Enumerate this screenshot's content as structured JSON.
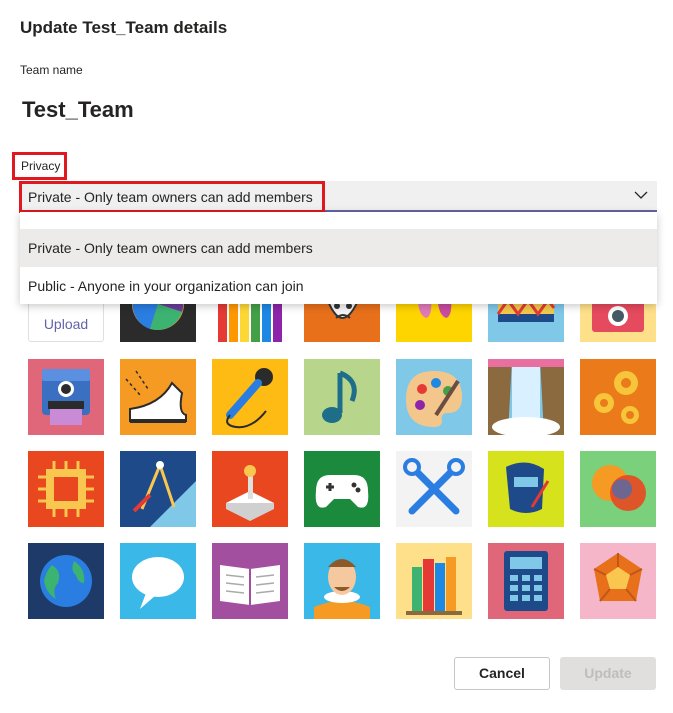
{
  "dialog": {
    "title": "Update Test_Team details",
    "team_name_label": "Team name",
    "team_name": "Test_Team",
    "privacy_label": "Privacy",
    "privacy_value": "Private - Only team owners can add members",
    "options": [
      "Private - Only team owners can add members",
      "Public - Anyone in your organization can join"
    ],
    "upload_label": "Upload",
    "cancel_label": "Cancel",
    "update_label": "Update"
  },
  "icons": {
    "row1": [
      "pie-chart-icon",
      "colored-pencils-icon",
      "theater-mask-icon",
      "ballet-shoes-icon",
      "drum-icon",
      "camera-icon"
    ],
    "row2": [
      "instant-camera-icon",
      "dance-shoe-icon",
      "microphone-icon",
      "music-note-icon",
      "paint-palette-icon",
      "waterfall-icon",
      "gears-icon"
    ],
    "row3": [
      "circuit-chip-icon",
      "drafting-tools-icon",
      "joystick-icon",
      "game-controller-icon",
      "wrench-tools-icon",
      "welding-mask-icon",
      "chat-bubbles-icon"
    ],
    "row4": [
      "globe-icon",
      "speech-bubble-icon",
      "open-book-icon",
      "shakespeare-icon",
      "books-icon",
      "calculator-icon",
      "dodecahedron-icon"
    ]
  },
  "colors": {
    "accent": "#6264a7",
    "highlight_border": "#e0181f"
  }
}
